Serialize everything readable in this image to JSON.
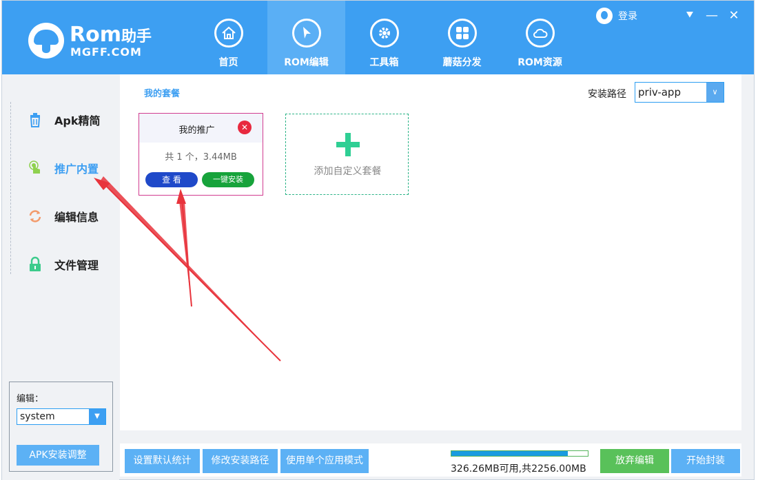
{
  "logo": {
    "title": "Rom",
    "title_cn": "助手",
    "subtitle": "MGFF.COM"
  },
  "nav": [
    {
      "label": "首页",
      "icon": "home-icon"
    },
    {
      "label": "ROM编辑",
      "icon": "cursor-icon",
      "active": true
    },
    {
      "label": "工具箱",
      "icon": "gear-icon"
    },
    {
      "label": "蘑菇分发",
      "icon": "grid-icon"
    },
    {
      "label": "ROM资源",
      "icon": "cloud-icon"
    }
  ],
  "login": {
    "label": "登录"
  },
  "window_controls": {
    "menu": "⯆",
    "minimize": "—",
    "close": "✕"
  },
  "sidebar": {
    "items": [
      {
        "label": "Apk精简",
        "icon": "trash-icon"
      },
      {
        "label": "推广内置",
        "icon": "touch-icon",
        "active": true
      },
      {
        "label": "编辑信息",
        "icon": "refresh-icon"
      },
      {
        "label": "文件管理",
        "icon": "lock-icon"
      }
    ],
    "edit_label": "编辑：",
    "edit_value": "system",
    "apk_button": "APK安装调整"
  },
  "main": {
    "section_title": "我的套餐",
    "install_path_label": "安装路径",
    "install_path_value": "priv-app",
    "package_card": {
      "title": "我的推广",
      "info": "共  1 个，3.44MB",
      "view_button": "查 看",
      "install_button": "一键安装"
    },
    "add_card_label": "添加自定义套餐"
  },
  "bottom": {
    "btn_default_stats": "设置默认统计",
    "btn_change_path": "修改安装路径",
    "btn_single_mode": "使用单个应用模式",
    "storage_text": "326.26MB可用,共2256.00MB",
    "storage_used_fraction": 0.855,
    "btn_discard": "放弃编辑",
    "btn_pack": "开始封装"
  },
  "colors": {
    "header": "#3d9ff2",
    "accent": "#3d9ff2",
    "discard": "#59c15a",
    "arrow": "#e8343c"
  }
}
